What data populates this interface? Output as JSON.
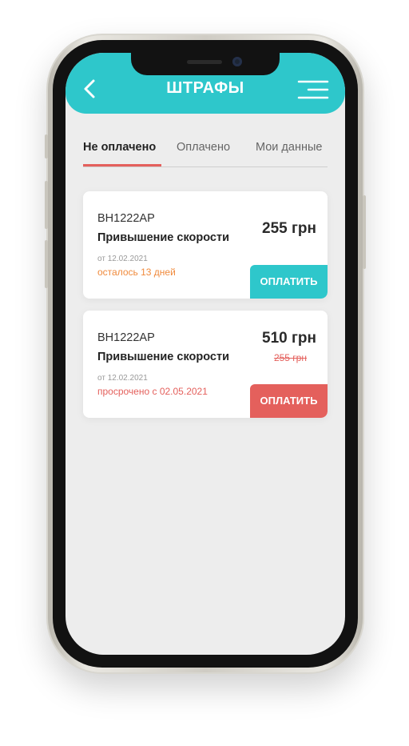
{
  "header": {
    "title": "ШТРАФЫ",
    "back_icon": "chevron-left-icon",
    "menu_icon": "menu-icon"
  },
  "tabs": [
    {
      "label": "Не оплачено",
      "active": true
    },
    {
      "label": "Оплачено",
      "active": false
    },
    {
      "label": "Мои данные",
      "active": false
    }
  ],
  "fines": [
    {
      "plate": "BH1222AP",
      "reason": "Привышение скорости",
      "date": "от 12.02.2021",
      "status": "осталось 13 дней",
      "status_color": "#f08a3c",
      "amount": "255 грн",
      "pay_label": "ОПЛАТИТЬ",
      "pay_color": "#2ec7cb"
    },
    {
      "plate": "BH1222AP",
      "reason": "Привышение скорости",
      "date": "от 12.02.2021",
      "status": "просрочено с 02.05.2021",
      "status_color": "#e4605c",
      "amount": "510 грн",
      "old_amount": "255 грн",
      "pay_label": "ОПЛАТИТЬ",
      "pay_color": "#e4605c"
    }
  ],
  "colors": {
    "accent": "#2ec7cb",
    "alert": "#e4605c",
    "warning": "#f08a3c"
  }
}
